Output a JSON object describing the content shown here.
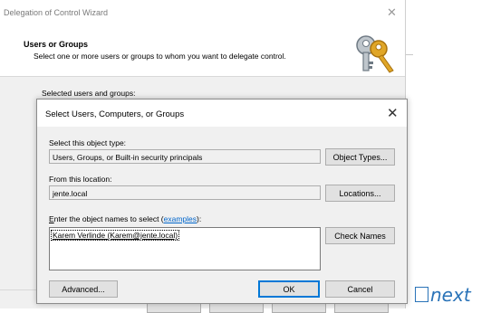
{
  "wizard": {
    "title": "Delegation of Control Wizard",
    "close_glyph": "✕",
    "header_title": "Users or Groups",
    "header_subtitle": "Select one or more users or groups to whom you want to delegate control.",
    "header_icon": "keys-icon",
    "selected_label": "Selected users and groups:"
  },
  "dialog": {
    "title": "Select Users, Computers, or Groups",
    "close_glyph": "✕",
    "object_type_label": "Select this object type:",
    "object_type_value": "Users, Groups, or Built-in security principals",
    "object_types_button": "Object Types...",
    "location_label": "From this location:",
    "location_value": "jente.local",
    "locations_button": "Locations...",
    "enter_names_label_accel": "E",
    "enter_names_label_rest": "nter the object names to select (",
    "examples_link": "examples",
    "enter_names_label_end": "):",
    "entered_name": "Karem Verlinde (Karem@jente.local)",
    "check_names_button": "Check Names",
    "advanced_button": "Advanced...",
    "ok_button": "OK",
    "cancel_button": "Cancel"
  },
  "overlay": {
    "next_text": "next"
  }
}
